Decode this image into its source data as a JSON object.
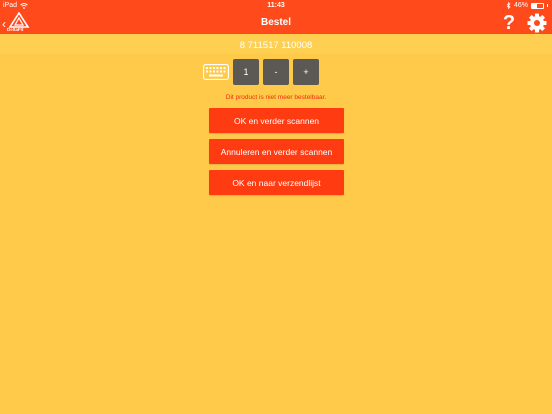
{
  "status": {
    "device": "iPad",
    "time": "11:43",
    "battery": "46%",
    "battery_level": 0.46
  },
  "nav": {
    "title": "Bestel",
    "logo_text": "DeltaFit",
    "help_label": "?"
  },
  "product": {
    "barcode": "8 711517 110008"
  },
  "quantity": {
    "value": "1",
    "decrement": "-",
    "increment": "+"
  },
  "message": {
    "error": "Dit product is niet meer bestelbaar."
  },
  "actions": {
    "ok_continue": "OK en verder scannen",
    "cancel_continue": "Annuleren en verder scannen",
    "ok_shipping": "OK en naar verzendlijst"
  },
  "colors": {
    "header": "#ff4a1c",
    "background": "#ffc94a",
    "button": "#ff3b12",
    "stepper": "#5c5854",
    "error_text": "#e8300c"
  },
  "icons": [
    "wifi-icon",
    "bluetooth-icon",
    "battery-icon",
    "back-chevron-icon",
    "logo-icon",
    "help-icon",
    "gear-icon",
    "keyboard-icon"
  ]
}
